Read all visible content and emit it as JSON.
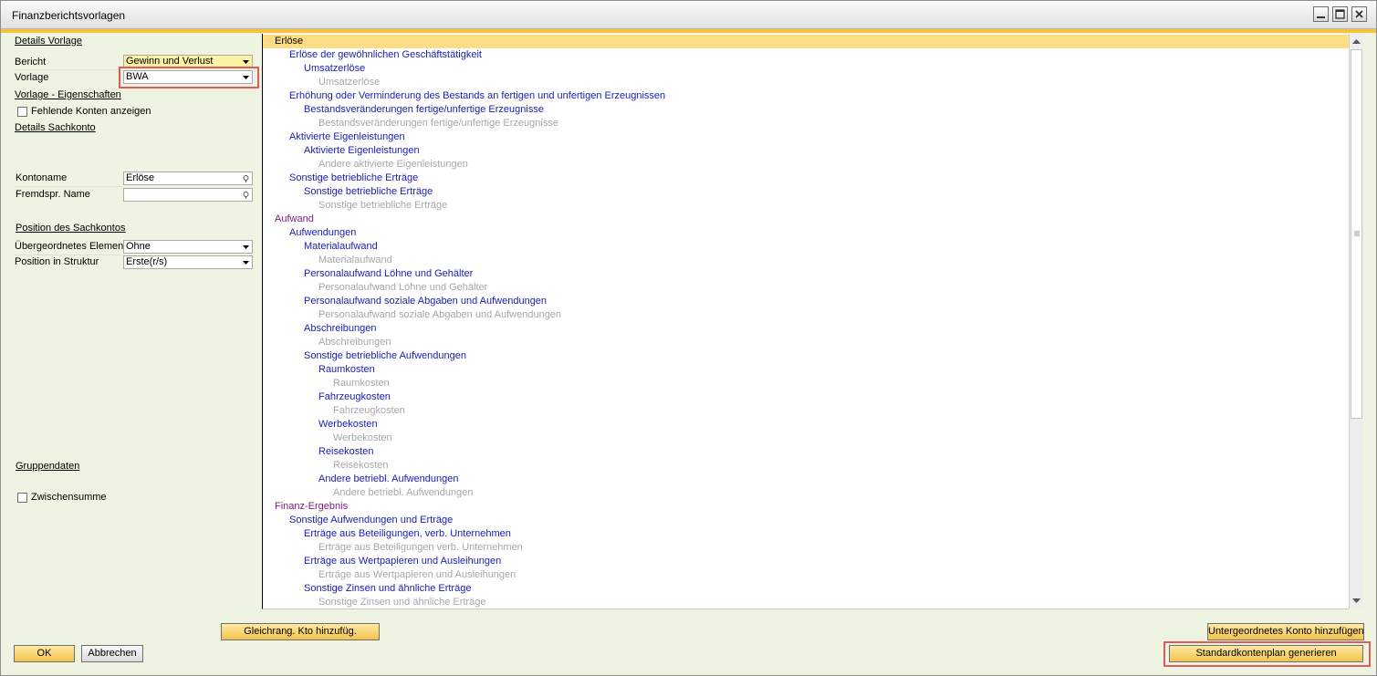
{
  "window": {
    "title": "Finanzberichtsvorlagen"
  },
  "left": {
    "details_vorlage": "Details Vorlage",
    "bericht_label": "Bericht",
    "bericht_value": "Gewinn und Verlust",
    "vorlage_label": "Vorlage",
    "vorlage_value": "BWA",
    "vorlage_eigenschaften": "Vorlage - Eigenschaften",
    "fehlende_konten": "Fehlende Konten anzeigen",
    "details_sachkonto": "Details Sachkonto",
    "kontoname_label": "Kontoname",
    "kontoname_value": "Erlöse",
    "fremdspr_label": "Fremdspr. Name",
    "fremdspr_value": "",
    "position_sachkontos": "Position des Sachkontos",
    "uebergeordnet_label": "Übergeordnetes Element",
    "uebergeordnet_value": "Ohne",
    "position_struktur_label": "Position in Struktur",
    "position_struktur_value": "Erste(r/s)",
    "gruppendaten": "Gruppendaten",
    "zwischensumme": "Zwischensumme"
  },
  "tree": [
    {
      "text": "Erlöse",
      "level": 0,
      "kind": "title",
      "selected": true
    },
    {
      "text": "Erlöse der gewöhnlichen Geschäftstätigkeit",
      "level": 1,
      "kind": "blue"
    },
    {
      "text": "Umsatzerlöse",
      "level": 2,
      "kind": "blue"
    },
    {
      "text": "Umsatzerlöse",
      "level": 3,
      "kind": "gray"
    },
    {
      "text": "Erhöhung oder Verminderung des Bestands an fertigen und unfertigen Erzeugnissen",
      "level": 1,
      "kind": "blue"
    },
    {
      "text": "Bestandsveränderungen fertige/unfertige Erzeugnisse",
      "level": 2,
      "kind": "blue"
    },
    {
      "text": "Bestandsveränderungen fertige/unfertige Erzeugnisse",
      "level": 3,
      "kind": "gray"
    },
    {
      "text": "Aktivierte Eigenleistungen",
      "level": 1,
      "kind": "blue"
    },
    {
      "text": "Aktivierte Eigenleistungen",
      "level": 2,
      "kind": "blue"
    },
    {
      "text": "Andere aktivierte Eigenleistungen",
      "level": 3,
      "kind": "gray"
    },
    {
      "text": "Sonstige betriebliche Erträge",
      "level": 1,
      "kind": "blue"
    },
    {
      "text": "Sonstige betriebliche Erträge",
      "level": 2,
      "kind": "blue"
    },
    {
      "text": "Sonstige betriebliche Erträge",
      "level": 3,
      "kind": "gray"
    },
    {
      "text": "Aufwand",
      "level": 0,
      "kind": "title"
    },
    {
      "text": "Aufwendungen",
      "level": 1,
      "kind": "blue"
    },
    {
      "text": "Materialaufwand",
      "level": 2,
      "kind": "blue"
    },
    {
      "text": "Materialaufwand",
      "level": 3,
      "kind": "gray"
    },
    {
      "text": "Personalaufwand Löhne und Gehälter",
      "level": 2,
      "kind": "blue"
    },
    {
      "text": "Personalaufwand Löhne und Gehälter",
      "level": 3,
      "kind": "gray"
    },
    {
      "text": "Personalaufwand soziale Abgaben und Aufwendungen",
      "level": 2,
      "kind": "blue"
    },
    {
      "text": "Personalaufwand soziale Abgaben und Aufwendungen",
      "level": 3,
      "kind": "gray"
    },
    {
      "text": "Abschreibungen",
      "level": 2,
      "kind": "blue"
    },
    {
      "text": "Abschreibungen",
      "level": 3,
      "kind": "gray"
    },
    {
      "text": "Sonstige betriebliche Aufwendungen",
      "level": 2,
      "kind": "blue"
    },
    {
      "text": "Raumkosten",
      "level": 3,
      "kind": "blue"
    },
    {
      "text": "Raumkosten",
      "level": 4,
      "kind": "gray"
    },
    {
      "text": "Fahrzeugkosten",
      "level": 3,
      "kind": "blue"
    },
    {
      "text": "Fahrzeugkosten",
      "level": 4,
      "kind": "gray"
    },
    {
      "text": "Werbekosten",
      "level": 3,
      "kind": "blue"
    },
    {
      "text": "Werbekosten",
      "level": 4,
      "kind": "gray"
    },
    {
      "text": "Reisekosten",
      "level": 3,
      "kind": "blue"
    },
    {
      "text": "Reisekosten",
      "level": 4,
      "kind": "gray"
    },
    {
      "text": "Andere betriebl. Aufwendungen",
      "level": 3,
      "kind": "blue"
    },
    {
      "text": "Andere betriebl. Aufwendungen",
      "level": 4,
      "kind": "gray"
    },
    {
      "text": "Finanz-Ergebnis",
      "level": 0,
      "kind": "title"
    },
    {
      "text": "Sonstige Aufwendungen und Erträge",
      "level": 1,
      "kind": "blue"
    },
    {
      "text": "Erträge aus Beteiligungen, verb. Unternehmen",
      "level": 2,
      "kind": "blue"
    },
    {
      "text": "Erträge aus Beteiligungen verb. Unternehmen",
      "level": 3,
      "kind": "gray"
    },
    {
      "text": "Erträge aus Wertpapieren und Ausleihungen",
      "level": 2,
      "kind": "blue"
    },
    {
      "text": "Erträge aus Wertpapieren und Ausleihungen",
      "level": 3,
      "kind": "gray"
    },
    {
      "text": "Sonstige Zinsen und ähnliche Erträge",
      "level": 2,
      "kind": "blue"
    },
    {
      "text": "Sonstige Zinsen und ähnliche Erträge",
      "level": 3,
      "kind": "gray"
    }
  ],
  "buttons": {
    "gleichrang": "Gleichrang. Kto hinzufüg.",
    "untergeordnet": "Untergeordnetes Konto hinzufügen",
    "ok": "OK",
    "abbrechen": "Abbrechen",
    "standardkontenplan": "Standardkontenplan generieren"
  },
  "colors": {
    "accent": "#f7c239",
    "selection": "#fedd84",
    "title_node": "#7e1a7e",
    "blue_node": "#1b21b3",
    "gray_node": "#a7a7a7",
    "highlight_box": "#e25a5a"
  },
  "icons": [
    "minimize-icon",
    "maximize-icon",
    "close-icon",
    "chevron-down-icon",
    "link-arrow-icon"
  ]
}
